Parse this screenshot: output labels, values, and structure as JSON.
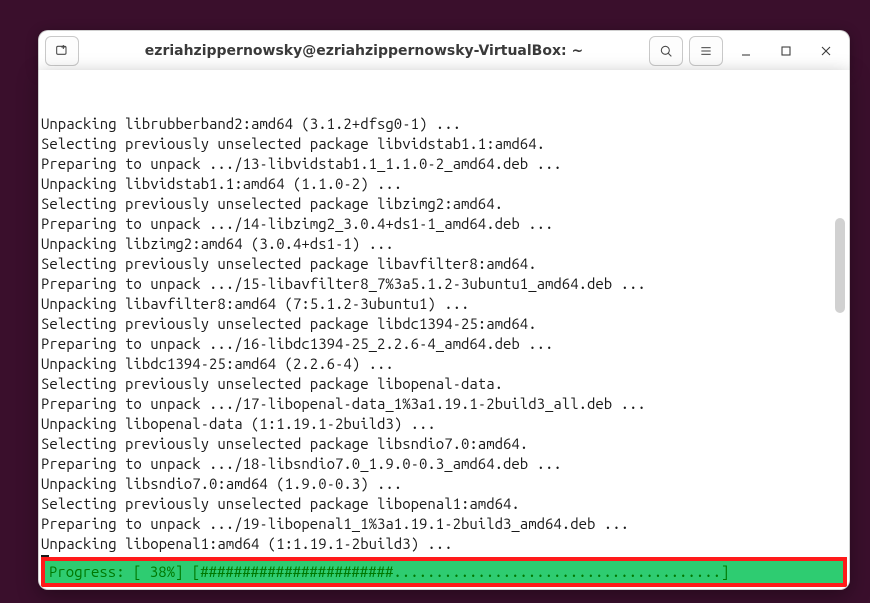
{
  "titlebar": {
    "title": "ezriahzippernowsky@ezriahzippernowsky-VirtualBox: ~",
    "new_tab_button": "new-tab",
    "search_button": "search",
    "menu_button": "menu",
    "minimize_button": "minimize",
    "maximize_button": "maximize",
    "close_button": "close"
  },
  "terminal": {
    "lines": [
      "Unpacking librubberband2:amd64 (3.1.2+dfsg0-1) ...",
      "Selecting previously unselected package libvidstab1.1:amd64.",
      "Preparing to unpack .../13-libvidstab1.1_1.1.0-2_amd64.deb ...",
      "Unpacking libvidstab1.1:amd64 (1.1.0-2) ...",
      "Selecting previously unselected package libzimg2:amd64.",
      "Preparing to unpack .../14-libzimg2_3.0.4+ds1-1_amd64.deb ...",
      "Unpacking libzimg2:amd64 (3.0.4+ds1-1) ...",
      "Selecting previously unselected package libavfilter8:amd64.",
      "Preparing to unpack .../15-libavfilter8_7%3a5.1.2-3ubuntu1_amd64.deb ...",
      "Unpacking libavfilter8:amd64 (7:5.1.2-3ubuntu1) ...",
      "Selecting previously unselected package libdc1394-25:amd64.",
      "Preparing to unpack .../16-libdc1394-25_2.2.6-4_amd64.deb ...",
      "Unpacking libdc1394-25:amd64 (2.2.6-4) ...",
      "Selecting previously unselected package libopenal-data.",
      "Preparing to unpack .../17-libopenal-data_1%3a1.19.1-2build3_all.deb ...",
      "Unpacking libopenal-data (1:1.19.1-2build3) ...",
      "Selecting previously unselected package libsndio7.0:amd64.",
      "Preparing to unpack .../18-libsndio7.0_1.9.0-0.3_amd64.deb ...",
      "Unpacking libsndio7.0:amd64 (1.9.0-0.3) ...",
      "Selecting previously unselected package libopenal1:amd64.",
      "Preparing to unpack .../19-libopenal1_1%3a1.19.1-2build3_amd64.deb ...",
      "Unpacking libopenal1:amd64 (1:1.19.1-2build3) ..."
    ],
    "progress": {
      "label": "Progress:",
      "percent": 38,
      "bar_filled": 23,
      "bar_total": 62,
      "text": "Progress: [ 38%] [#######################.......................................]"
    }
  },
  "colors": {
    "wallpaper": "#3a0f2c",
    "window_bg": "#ffffff",
    "terminal_bg": "#ffffff",
    "terminal_fg": "#1a1a1a",
    "progress_bg": "#2ecc71",
    "progress_fg": "#007800",
    "highlight_border": "#ff1a1a"
  },
  "scrollbar": {
    "thumb_top_pct": 30,
    "thumb_height_pct": 20
  }
}
